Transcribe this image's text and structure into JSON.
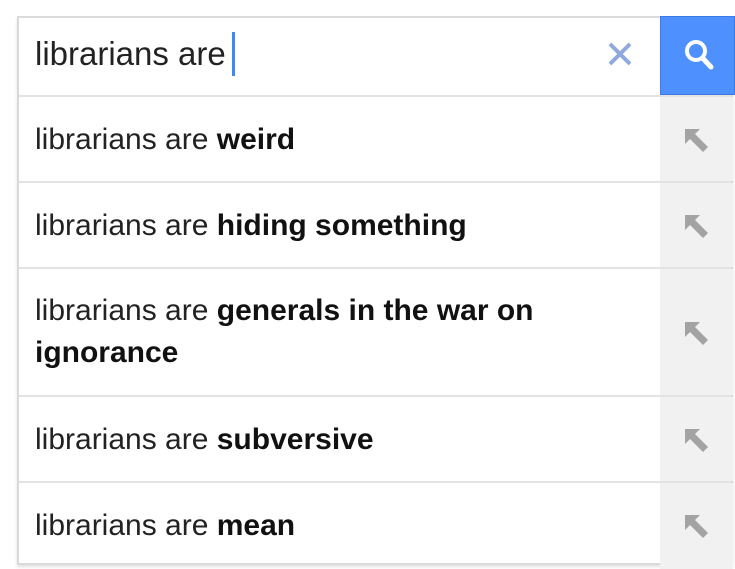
{
  "search": {
    "query": "librarians are",
    "clear_icon": "close-icon",
    "submit_icon": "search-icon",
    "accent_color": "#4d90fe",
    "caret_color": "#4285f4"
  },
  "suggestions": [
    {
      "prefix": "librarians are ",
      "completion": "weird",
      "icon": "arrow-up-left-icon"
    },
    {
      "prefix": "librarians are ",
      "completion": "hiding something",
      "icon": "arrow-up-left-icon"
    },
    {
      "prefix": "librarians are ",
      "completion": "generals in the war on ignorance",
      "icon": "arrow-up-left-icon"
    },
    {
      "prefix": "librarians are ",
      "completion": "subversive",
      "icon": "arrow-up-left-icon"
    },
    {
      "prefix": "librarians are ",
      "completion": "mean",
      "icon": "arrow-up-left-icon"
    }
  ]
}
